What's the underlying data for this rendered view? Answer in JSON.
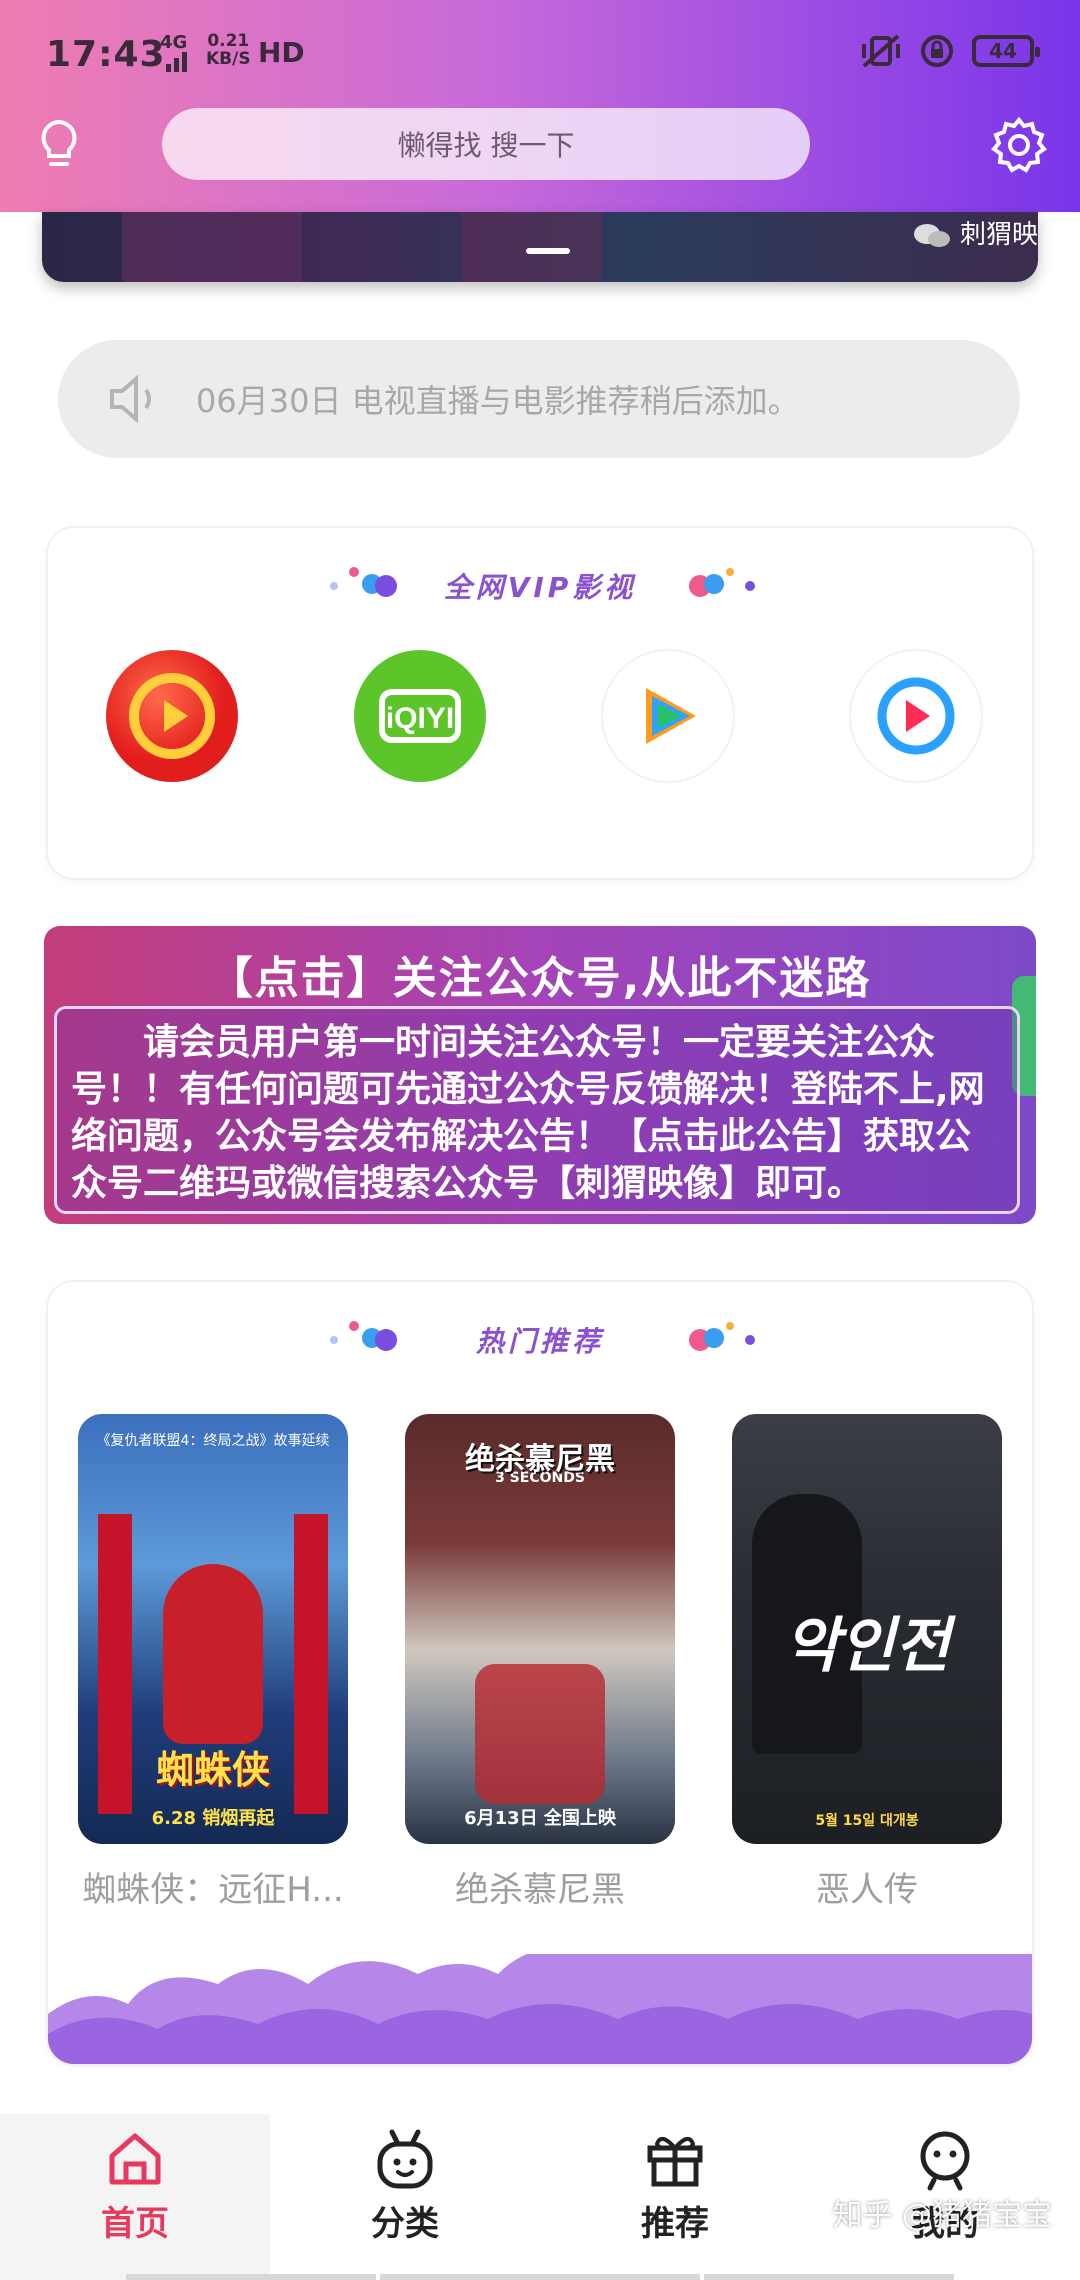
{
  "status_bar": {
    "time": "17:43",
    "network": "4G",
    "speed_value": "0.21",
    "speed_unit": "KB/S",
    "hd": "HD",
    "battery": "44"
  },
  "header": {
    "search_placeholder": "懒得找 搜一下"
  },
  "banner": {
    "tag": "刺猬映"
  },
  "notice": {
    "text": "06月30日 电视直播与电影推荐稍后添加。"
  },
  "vip_section": {
    "title": "全网VIP影视",
    "apps": [
      {
        "icon": "huya-video-icon"
      },
      {
        "icon": "iqiyi-icon",
        "label": "iQIYI"
      },
      {
        "icon": "tencent-video-icon"
      },
      {
        "icon": "youku-icon"
      }
    ]
  },
  "promo": {
    "title": "【点击】关注公众号,从此不迷路",
    "body": "请会员用户第一时间关注公众号！一定要关注公众号！！有任何问题可先通过公众号反馈解决！登陆不上,网络问题，公众号会发布解决公告！【点击此公告】获取公众号二维玛或微信搜索公众号【刺猬映像】即可。"
  },
  "hot_section": {
    "title": "热门推荐",
    "movies": [
      {
        "name": "蜘蛛侠：远征H...",
        "poster_title": "蜘蛛侠",
        "poster_sub": "6.28 销烟再起",
        "poster_top": "《复仇者联盟4：终局之战》故事延续"
      },
      {
        "name": "绝杀慕尼黑",
        "poster_title": "绝杀慕尼黑",
        "poster_sub": "6月13日 全国上映",
        "poster_top": "3 SECONDS"
      },
      {
        "name": "恶人传",
        "poster_title": "악인전",
        "poster_sub": "5월 15일 대개봉",
        "poster_top": ""
      }
    ]
  },
  "bottom_nav": {
    "items": [
      {
        "label": "首页",
        "icon": "home-icon"
      },
      {
        "label": "分类",
        "icon": "robot-face-icon"
      },
      {
        "label": "推荐",
        "icon": "gift-icon"
      },
      {
        "label": "我的",
        "icon": "user-icon"
      }
    ]
  },
  "watermark": "知乎 @猪猪宝宝",
  "colors": {
    "header_start": "#ef7db2",
    "header_end": "#7a35ea",
    "accent_purple": "#8a52d1",
    "active_nav": "#e8385c"
  }
}
